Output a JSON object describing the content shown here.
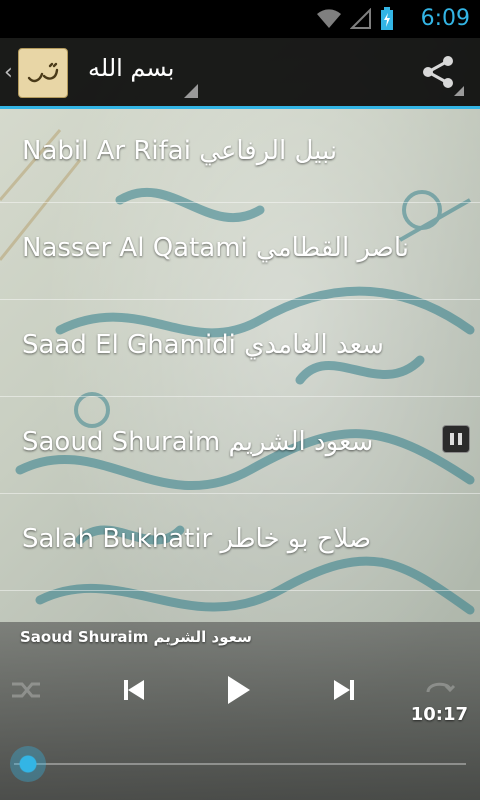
{
  "status": {
    "time": "6:09"
  },
  "header": {
    "title": "بسم الله"
  },
  "reciters": [
    {
      "label": "Nabil Ar Rifai نبيل الرفاعي",
      "playing": false
    },
    {
      "label": "Nasser Al Qatami ناصر القطامي",
      "playing": false
    },
    {
      "label": "Saad El Ghamidi سعد الغامدي",
      "playing": false
    },
    {
      "label": "Saoud Shuraim سعود الشريم",
      "playing": true
    },
    {
      "label": "Salah Bukhatir صلاح بو خاطر",
      "playing": false
    }
  ],
  "player": {
    "now_playing": "Saoud Shuraim سعود الشريم",
    "elapsed": "10:17",
    "progress": 0.0
  },
  "colors": {
    "accent": "#33b5e5"
  },
  "icons": [
    "back-chevron-icon",
    "app-logo-icon",
    "share-icon",
    "wifi-icon",
    "signal-icon",
    "battery-icon",
    "pause-icon",
    "previous-icon",
    "play-icon",
    "next-icon",
    "shuffle-icon",
    "repeat-icon"
  ]
}
